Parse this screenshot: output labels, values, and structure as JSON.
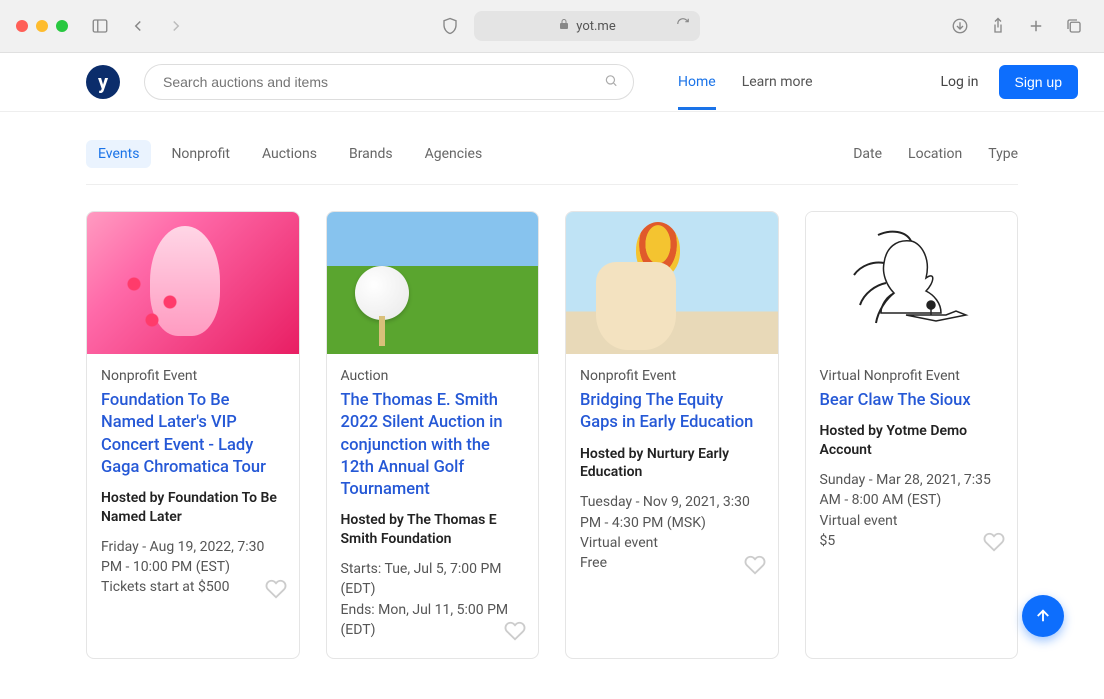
{
  "browser": {
    "url": "yot.me"
  },
  "header": {
    "search_placeholder": "Search auctions and items",
    "nav": {
      "home": "Home",
      "learn": "Learn more"
    },
    "login": "Log in",
    "signup": "Sign up"
  },
  "filters": {
    "tabs": [
      "Events",
      "Nonprofit",
      "Auctions",
      "Brands",
      "Agencies"
    ],
    "right": [
      "Date",
      "Location",
      "Type"
    ]
  },
  "cards": [
    {
      "type": "Nonprofit Event",
      "title": "Foundation To Be Named Later's VIP Concert Event - Lady Gaga Chromatica Tour",
      "host": "Hosted by Foundation To Be Named Later",
      "meta1": "Friday - Aug 19, 2022, 7:30 PM - 10:00 PM (EST)",
      "meta2": "Tickets start at $500"
    },
    {
      "type": "Auction",
      "title": "The Thomas E. Smith 2022 Silent Auction in conjunction with the 12th Annual Golf Tournament",
      "host": "Hosted by The Thomas E Smith Foundation",
      "meta1": "Starts: Tue, Jul 5, 7:00 PM (EDT)",
      "meta2": "Ends: Mon, Jul 11, 5:00 PM (EDT)"
    },
    {
      "type": "Nonprofit Event",
      "title": "Bridging The Equity Gaps in Early Education",
      "host": "Hosted by Nurtury Early Education",
      "meta1": "Tuesday - Nov 9, 2021, 3:30 PM - 4:30 PM (MSK)",
      "meta2": "Virtual event",
      "meta3": "Free"
    },
    {
      "type": "Virtual Nonprofit Event",
      "title": "Bear Claw The Sioux",
      "host": "Hosted by Yotme Demo Account",
      "meta1": "Sunday - Mar 28, 2021, 7:35 AM - 8:00 AM  (EST)",
      "meta2": "Virtual event",
      "meta3": "$5"
    }
  ]
}
